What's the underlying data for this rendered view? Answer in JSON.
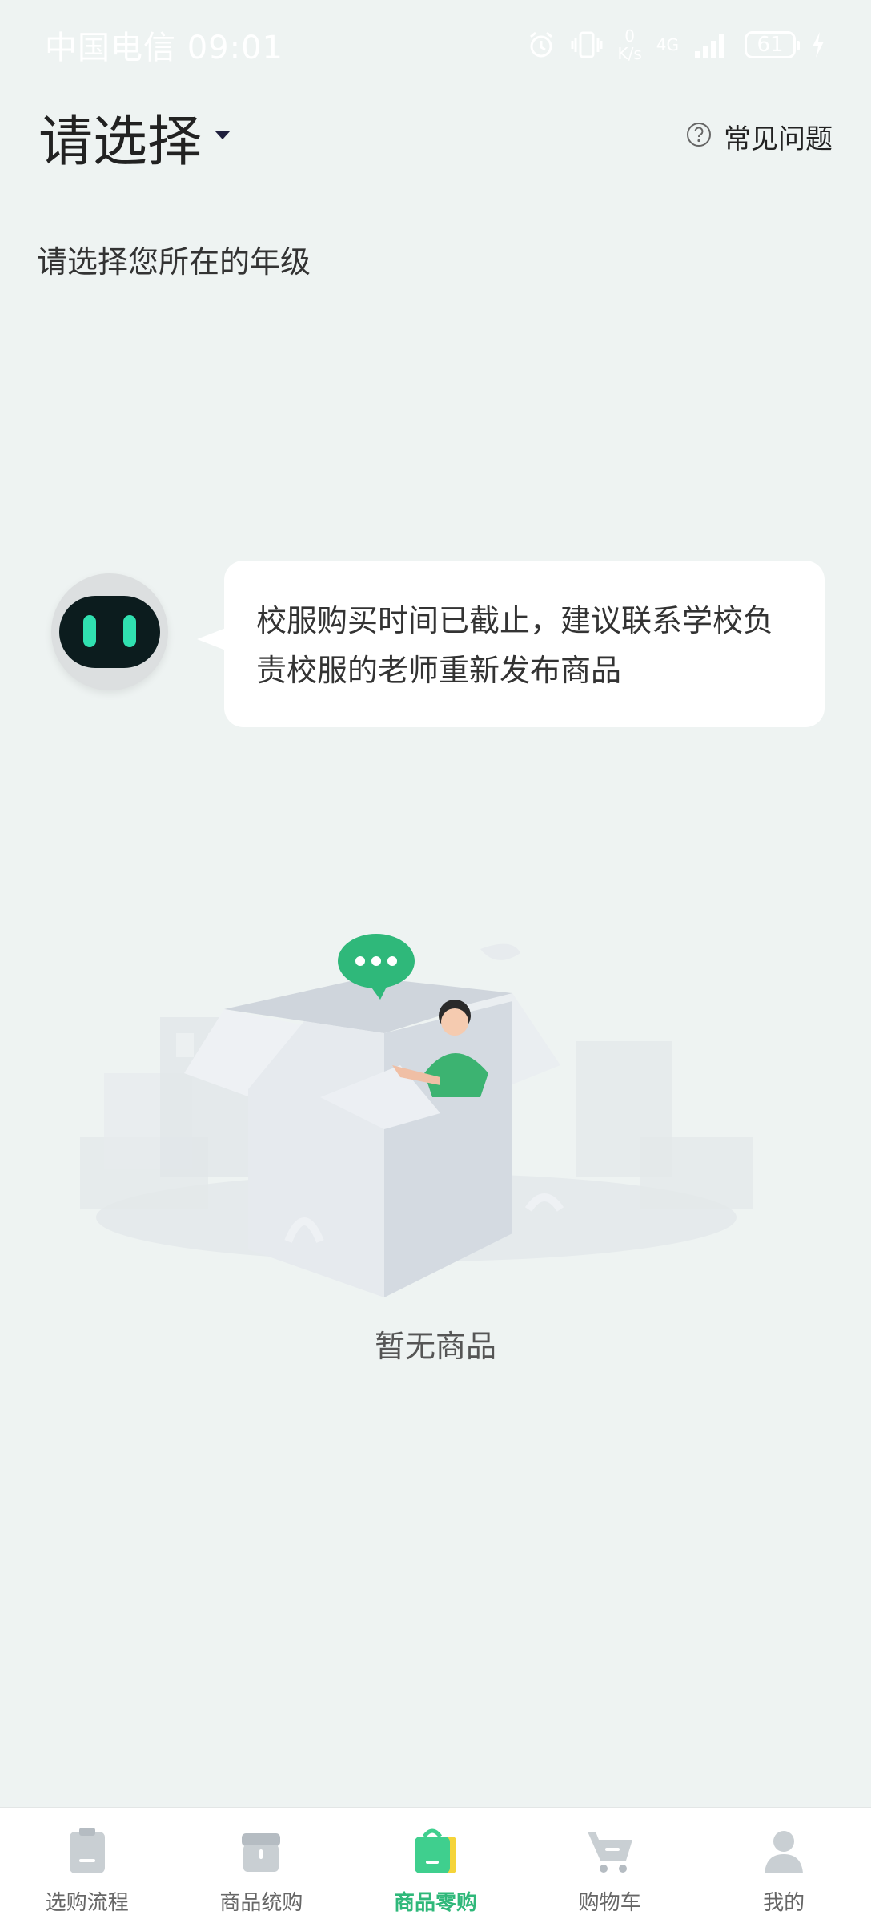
{
  "status_bar": {
    "carrier_time": "中国电信 09:01",
    "net_speed_value": "0",
    "net_speed_unit": "K/s",
    "network": "4G",
    "battery": "61"
  },
  "header": {
    "title": "请选择",
    "faq_label": "常见问题"
  },
  "subtitle": "请选择您所在的年级",
  "bot_message": "校服购买时间已截止，建议联系学校负责校服的老师重新发布商品",
  "empty_state": {
    "text": "暂无商品"
  },
  "tabbar": {
    "active_color": "#2fb87a",
    "inactive_color": "#c9cfd3",
    "items": [
      {
        "label": "选购流程",
        "icon": "clipboard-icon"
      },
      {
        "label": "商品统购",
        "icon": "store-icon"
      },
      {
        "label": "商品零购",
        "icon": "shopping-bag-icon",
        "active": true
      },
      {
        "label": "购物车",
        "icon": "cart-icon"
      },
      {
        "label": "我的",
        "icon": "user-icon"
      }
    ]
  }
}
